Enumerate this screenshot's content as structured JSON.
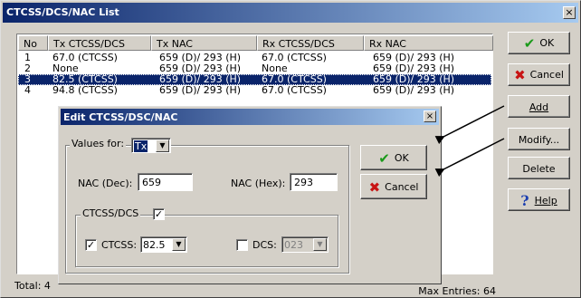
{
  "window": {
    "title": "CTCSS/DCS/NAC List",
    "close_glyph": "×"
  },
  "list": {
    "columns": [
      "No",
      "Tx CTCSS/DCS",
      "Tx NAC",
      "Rx CTCSS/DCS",
      "Rx NAC"
    ],
    "rows": [
      {
        "no": "1",
        "tx_ctcss": "67.0  (CTCSS)",
        "tx_nac": "659 (D)/ 293 (H)",
        "rx_ctcss": "67.0  (CTCSS)",
        "rx_nac": "659 (D)/ 293 (H)",
        "selected": false
      },
      {
        "no": "2",
        "tx_ctcss": "None",
        "tx_nac": "659 (D)/ 293 (H)",
        "rx_ctcss": "None",
        "rx_nac": "659 (D)/ 293 (H)",
        "selected": false
      },
      {
        "no": "3",
        "tx_ctcss": "82.5  (CTCSS)",
        "tx_nac": "659 (D)/ 293 (H)",
        "rx_ctcss": "67.0  (CTCSS)",
        "rx_nac": "659 (D)/ 293 (H)",
        "selected": true
      },
      {
        "no": "4",
        "tx_ctcss": "94.8  (CTCSS)",
        "tx_nac": "659 (D)/ 293 (H)",
        "rx_ctcss": "67.0  (CTCSS)",
        "rx_nac": "659 (D)/ 293 (H)",
        "selected": false
      }
    ]
  },
  "buttons": {
    "ok": "OK",
    "cancel": "Cancel",
    "add": "Add",
    "modify": "Modify...",
    "delete": "Delete",
    "help": "Help"
  },
  "status": {
    "total": "Total: 4",
    "max_entries": "Max Entries: 64"
  },
  "dialog": {
    "title": "Edit CTCSS/DSC/NAC",
    "close_glyph": "×",
    "values_for_label": "Values for:",
    "values_for_value": "Tx",
    "nac_dec_label": "NAC (Dec):",
    "nac_dec_value": "659",
    "nac_hex_label": "NAC (Hex):",
    "nac_hex_value": "293",
    "ctcss_dcs_group_label": "CTCSS/DCS",
    "ctcss_dcs_group_checked": true,
    "ctcss_label": "CTCSS:",
    "ctcss_checked": true,
    "ctcss_value": "82.5",
    "dcs_label": "DCS:",
    "dcs_checked": false,
    "dcs_value": "023",
    "ok": "OK",
    "cancel": "Cancel"
  },
  "icons": {
    "check": "check-icon",
    "cancel": "x-icon",
    "help": "question-icon"
  },
  "colors": {
    "title_bar": "#0a246a",
    "selection": "#0a246a",
    "ok_check": "#1a9a1a",
    "cancel_x": "#c81414",
    "help": "#1c3fb0"
  }
}
